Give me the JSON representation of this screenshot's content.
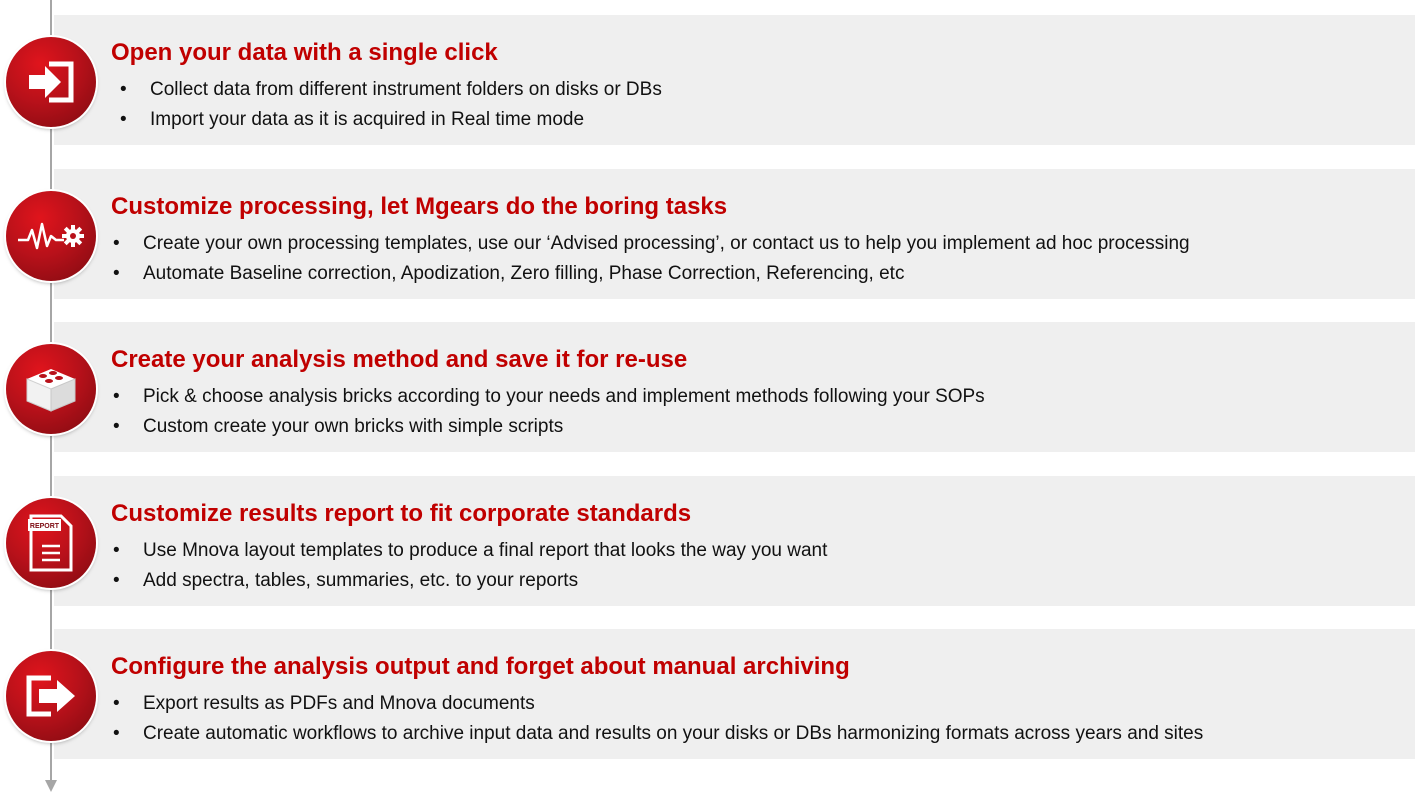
{
  "steps": [
    {
      "icon": "import-arrow-icon",
      "title": "Open your data with a single click",
      "bullets": [
        "Collect data from different instrument folders on disks or DBs",
        "Import your data as it is acquired in Real time mode"
      ]
    },
    {
      "icon": "processing-waveform-gear-icon",
      "title": "Customize processing, let Mgears do the boring tasks",
      "bullets": [
        "Create your own processing templates, use our ‘Advised processing’, or contact us to help you implement ad hoc processing",
        "Automate Baseline correction, Apodization, Zero filling, Phase Correction, Referencing,  etc"
      ]
    },
    {
      "icon": "analysis-brick-icon",
      "title": "Create your analysis method and save it for re-use",
      "bullets": [
        "Pick & choose analysis bricks according to your needs and implement methods following your SOPs",
        "Custom create your own bricks with simple scripts"
      ]
    },
    {
      "icon": "report-document-icon",
      "icon_text": "REPORT",
      "title": "Customize results report to fit corporate standards",
      "bullets": [
        "Use Mnova layout templates to produce a final report that looks the way you want",
        "Add spectra, tables, summaries, etc. to your reports"
      ]
    },
    {
      "icon": "export-arrow-icon",
      "title": "Configure the analysis output and forget about manual archiving",
      "bullets": [
        "Export results as PDFs and Mnova documents",
        "Create automatic workflows to archive input data and results on your disks or DBs harmonizing formats across years and sites"
      ]
    }
  ],
  "colors": {
    "accent": "#c00000",
    "icon_red": "#b8111a",
    "panel": "#efefef",
    "timeline": "#a6a6a6"
  }
}
